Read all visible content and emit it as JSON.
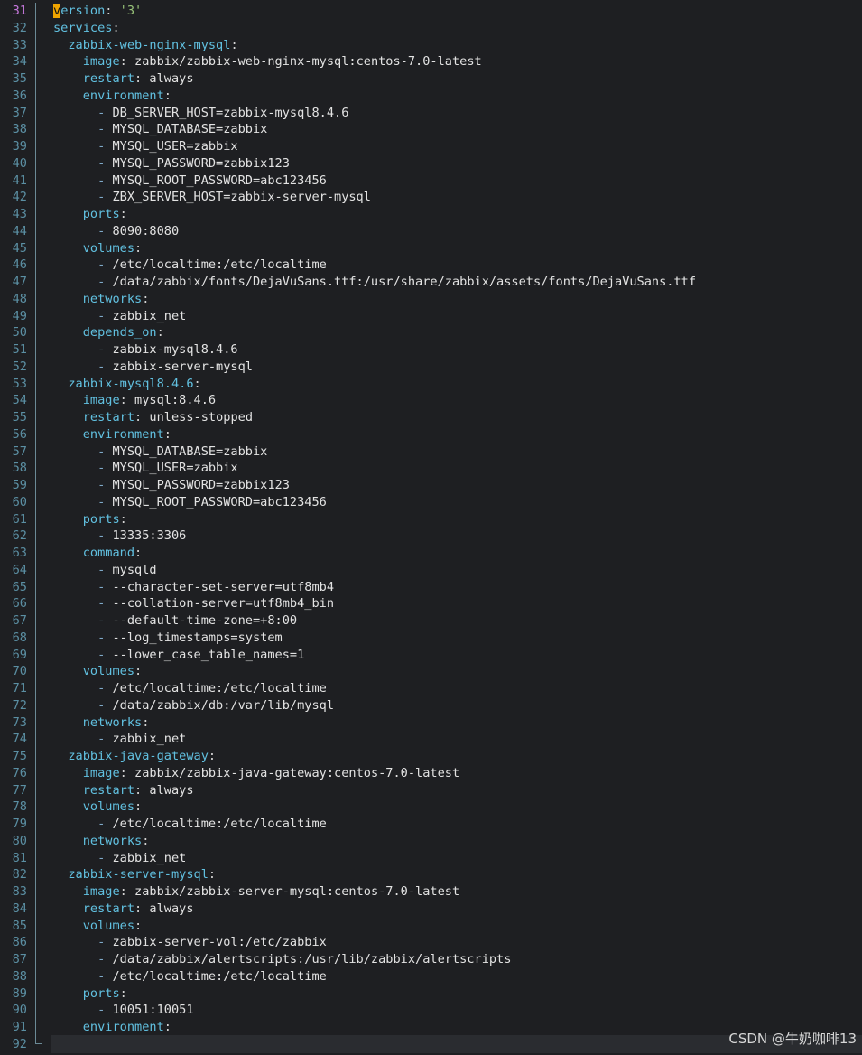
{
  "editor": {
    "current_line": "31",
    "lines": [
      {
        "num": "31",
        "indent": "",
        "key": "version",
        "dash": "",
        "sep": ": ",
        "value": "'3'",
        "value_type": "s",
        "cursor": true
      },
      {
        "num": "32",
        "indent": "",
        "key": "services",
        "dash": "",
        "sep": ":",
        "value": ""
      },
      {
        "num": "33",
        "indent": "  ",
        "key": "zabbix-web-nginx-mysql",
        "dash": "",
        "sep": ":",
        "value": ""
      },
      {
        "num": "34",
        "indent": "    ",
        "key": "image",
        "dash": "",
        "sep": ": ",
        "value": "zabbix/zabbix-web-nginx-mysql:centos-7.0-latest"
      },
      {
        "num": "35",
        "indent": "    ",
        "key": "restart",
        "dash": "",
        "sep": ": ",
        "value": "always"
      },
      {
        "num": "36",
        "indent": "    ",
        "key": "environment",
        "dash": "",
        "sep": ":",
        "value": ""
      },
      {
        "num": "37",
        "indent": "      ",
        "key": "",
        "dash": "- ",
        "sep": "",
        "value": "DB_SERVER_HOST=zabbix-mysql8.4.6"
      },
      {
        "num": "38",
        "indent": "      ",
        "key": "",
        "dash": "- ",
        "sep": "",
        "value": "MYSQL_DATABASE=zabbix"
      },
      {
        "num": "39",
        "indent": "      ",
        "key": "",
        "dash": "- ",
        "sep": "",
        "value": "MYSQL_USER=zabbix"
      },
      {
        "num": "40",
        "indent": "      ",
        "key": "",
        "dash": "- ",
        "sep": "",
        "value": "MYSQL_PASSWORD=zabbix123"
      },
      {
        "num": "41",
        "indent": "      ",
        "key": "",
        "dash": "- ",
        "sep": "",
        "value": "MYSQL_ROOT_PASSWORD=abc123456"
      },
      {
        "num": "42",
        "indent": "      ",
        "key": "",
        "dash": "- ",
        "sep": "",
        "value": "ZBX_SERVER_HOST=zabbix-server-mysql"
      },
      {
        "num": "43",
        "indent": "    ",
        "key": "ports",
        "dash": "",
        "sep": ":",
        "value": ""
      },
      {
        "num": "44",
        "indent": "      ",
        "key": "",
        "dash": "- ",
        "sep": "",
        "value": "8090:8080"
      },
      {
        "num": "45",
        "indent": "    ",
        "key": "volumes",
        "dash": "",
        "sep": ":",
        "value": ""
      },
      {
        "num": "46",
        "indent": "      ",
        "key": "",
        "dash": "- ",
        "sep": "",
        "value": "/etc/localtime:/etc/localtime"
      },
      {
        "num": "47",
        "indent": "      ",
        "key": "",
        "dash": "- ",
        "sep": "",
        "value": "/data/zabbix/fonts/DejaVuSans.ttf:/usr/share/zabbix/assets/fonts/DejaVuSans.ttf"
      },
      {
        "num": "48",
        "indent": "    ",
        "key": "networks",
        "dash": "",
        "sep": ":",
        "value": ""
      },
      {
        "num": "49",
        "indent": "      ",
        "key": "",
        "dash": "- ",
        "sep": "",
        "value": "zabbix_net"
      },
      {
        "num": "50",
        "indent": "    ",
        "key": "depends_on",
        "dash": "",
        "sep": ":",
        "value": ""
      },
      {
        "num": "51",
        "indent": "      ",
        "key": "",
        "dash": "- ",
        "sep": "",
        "value": "zabbix-mysql8.4.6"
      },
      {
        "num": "52",
        "indent": "      ",
        "key": "",
        "dash": "- ",
        "sep": "",
        "value": "zabbix-server-mysql"
      },
      {
        "num": "53",
        "indent": "  ",
        "key": "zabbix-mysql8.4.6",
        "dash": "",
        "sep": ":",
        "value": ""
      },
      {
        "num": "54",
        "indent": "    ",
        "key": "image",
        "dash": "",
        "sep": ": ",
        "value": "mysql:8.4.6"
      },
      {
        "num": "55",
        "indent": "    ",
        "key": "restart",
        "dash": "",
        "sep": ": ",
        "value": "unless-stopped"
      },
      {
        "num": "56",
        "indent": "    ",
        "key": "environment",
        "dash": "",
        "sep": ":",
        "value": ""
      },
      {
        "num": "57",
        "indent": "      ",
        "key": "",
        "dash": "- ",
        "sep": "",
        "value": "MYSQL_DATABASE=zabbix"
      },
      {
        "num": "58",
        "indent": "      ",
        "key": "",
        "dash": "- ",
        "sep": "",
        "value": "MYSQL_USER=zabbix"
      },
      {
        "num": "59",
        "indent": "      ",
        "key": "",
        "dash": "- ",
        "sep": "",
        "value": "MYSQL_PASSWORD=zabbix123"
      },
      {
        "num": "60",
        "indent": "      ",
        "key": "",
        "dash": "- ",
        "sep": "",
        "value": "MYSQL_ROOT_PASSWORD=abc123456"
      },
      {
        "num": "61",
        "indent": "    ",
        "key": "ports",
        "dash": "",
        "sep": ":",
        "value": ""
      },
      {
        "num": "62",
        "indent": "      ",
        "key": "",
        "dash": "- ",
        "sep": "",
        "value": "13335:3306"
      },
      {
        "num": "63",
        "indent": "    ",
        "key": "command",
        "dash": "",
        "sep": ":",
        "value": ""
      },
      {
        "num": "64",
        "indent": "      ",
        "key": "",
        "dash": "- ",
        "sep": "",
        "value": "mysqld"
      },
      {
        "num": "65",
        "indent": "      ",
        "key": "",
        "dash": "- ",
        "sep": "",
        "value": "--character-set-server=utf8mb4"
      },
      {
        "num": "66",
        "indent": "      ",
        "key": "",
        "dash": "- ",
        "sep": "",
        "value": "--collation-server=utf8mb4_bin"
      },
      {
        "num": "67",
        "indent": "      ",
        "key": "",
        "dash": "- ",
        "sep": "",
        "value": "--default-time-zone=+8:00"
      },
      {
        "num": "68",
        "indent": "      ",
        "key": "",
        "dash": "- ",
        "sep": "",
        "value": "--log_timestamps=system"
      },
      {
        "num": "69",
        "indent": "      ",
        "key": "",
        "dash": "- ",
        "sep": "",
        "value": "--lower_case_table_names=1"
      },
      {
        "num": "70",
        "indent": "    ",
        "key": "volumes",
        "dash": "",
        "sep": ":",
        "value": ""
      },
      {
        "num": "71",
        "indent": "      ",
        "key": "",
        "dash": "- ",
        "sep": "",
        "value": "/etc/localtime:/etc/localtime"
      },
      {
        "num": "72",
        "indent": "      ",
        "key": "",
        "dash": "- ",
        "sep": "",
        "value": "/data/zabbix/db:/var/lib/mysql"
      },
      {
        "num": "73",
        "indent": "    ",
        "key": "networks",
        "dash": "",
        "sep": ":",
        "value": ""
      },
      {
        "num": "74",
        "indent": "      ",
        "key": "",
        "dash": "- ",
        "sep": "",
        "value": "zabbix_net"
      },
      {
        "num": "75",
        "indent": "  ",
        "key": "zabbix-java-gateway",
        "dash": "",
        "sep": ":",
        "value": ""
      },
      {
        "num": "76",
        "indent": "    ",
        "key": "image",
        "dash": "",
        "sep": ": ",
        "value": "zabbix/zabbix-java-gateway:centos-7.0-latest"
      },
      {
        "num": "77",
        "indent": "    ",
        "key": "restart",
        "dash": "",
        "sep": ": ",
        "value": "always"
      },
      {
        "num": "78",
        "indent": "    ",
        "key": "volumes",
        "dash": "",
        "sep": ":",
        "value": ""
      },
      {
        "num": "79",
        "indent": "      ",
        "key": "",
        "dash": "- ",
        "sep": "",
        "value": "/etc/localtime:/etc/localtime"
      },
      {
        "num": "80",
        "indent": "    ",
        "key": "networks",
        "dash": "",
        "sep": ":",
        "value": ""
      },
      {
        "num": "81",
        "indent": "      ",
        "key": "",
        "dash": "- ",
        "sep": "",
        "value": "zabbix_net"
      },
      {
        "num": "82",
        "indent": "  ",
        "key": "zabbix-server-mysql",
        "dash": "",
        "sep": ":",
        "value": ""
      },
      {
        "num": "83",
        "indent": "    ",
        "key": "image",
        "dash": "",
        "sep": ": ",
        "value": "zabbix/zabbix-server-mysql:centos-7.0-latest"
      },
      {
        "num": "84",
        "indent": "    ",
        "key": "restart",
        "dash": "",
        "sep": ": ",
        "value": "always"
      },
      {
        "num": "85",
        "indent": "    ",
        "key": "volumes",
        "dash": "",
        "sep": ":",
        "value": ""
      },
      {
        "num": "86",
        "indent": "      ",
        "key": "",
        "dash": "- ",
        "sep": "",
        "value": "zabbix-server-vol:/etc/zabbix"
      },
      {
        "num": "87",
        "indent": "      ",
        "key": "",
        "dash": "- ",
        "sep": "",
        "value": "/data/zabbix/alertscripts:/usr/lib/zabbix/alertscripts"
      },
      {
        "num": "88",
        "indent": "      ",
        "key": "",
        "dash": "- ",
        "sep": "",
        "value": "/etc/localtime:/etc/localtime"
      },
      {
        "num": "89",
        "indent": "    ",
        "key": "ports",
        "dash": "",
        "sep": ":",
        "value": ""
      },
      {
        "num": "90",
        "indent": "      ",
        "key": "",
        "dash": "- ",
        "sep": "",
        "value": "10051:10051"
      },
      {
        "num": "91",
        "indent": "    ",
        "key": "environment",
        "dash": "",
        "sep": ":",
        "value": ""
      },
      {
        "num": "92",
        "indent": "",
        "key": "",
        "dash": "",
        "sep": "",
        "value": ""
      }
    ]
  },
  "watermark": "CSDN @牛奶咖啡13",
  "colors": {
    "background": "#1e1f22",
    "key": "#61c0e0",
    "string": "#98c379",
    "line_number": "#5b8fa3",
    "current_line_number": "#c678dd",
    "cursor": "#f0a500"
  }
}
